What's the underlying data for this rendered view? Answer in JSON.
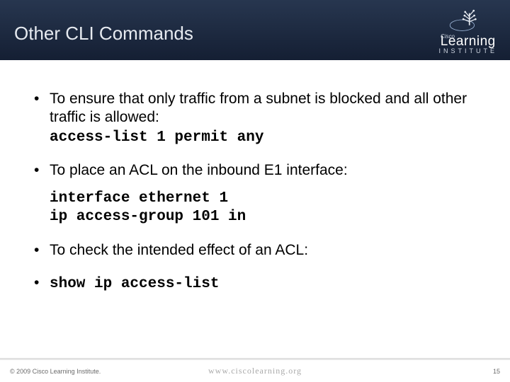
{
  "header": {
    "title": "Other CLI Commands",
    "brand_top": "Learning",
    "brand_sub": "INSTITUTE",
    "brand_parent": "Cisco"
  },
  "bullets": [
    {
      "text": "To ensure that only traffic from a subnet is blocked and all other traffic is allowed:",
      "code": "access-list 1 permit any"
    },
    {
      "text": "To place an ACL on the inbound E1 interface:",
      "code_block": [
        "interface ethernet 1",
        "ip access-group 101 in"
      ]
    },
    {
      "text": "To check the intended effect of an ACL:"
    },
    {
      "code_inline": "show ip access-list"
    }
  ],
  "footer": {
    "copyright": "© 2009 Cisco Learning Institute.",
    "url": "www.ciscolearning.org",
    "page": "15"
  }
}
